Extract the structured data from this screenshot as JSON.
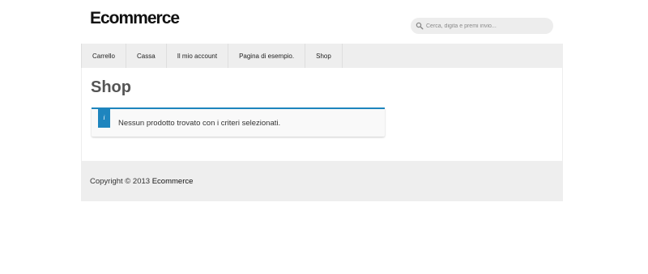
{
  "header": {
    "site_title": "Ecommerce",
    "search": {
      "icon": "search-icon",
      "placeholder": "Cerca, digita e premi invio..."
    }
  },
  "nav": {
    "items": [
      {
        "label": "Carrello"
      },
      {
        "label": "Cassa"
      },
      {
        "label": "Il mio account"
      },
      {
        "label": "Pagina di esempio."
      },
      {
        "label": "Shop"
      }
    ]
  },
  "main": {
    "page_title": "Shop",
    "notice": {
      "icon": "info-icon",
      "icon_glyph": "i",
      "message": "Nessun prodotto trovato con i criteri selezionati.",
      "accent_color": "#1e85be"
    }
  },
  "footer": {
    "copyright_prefix": "Copyright © 2013",
    "brand": "Ecommerce"
  }
}
